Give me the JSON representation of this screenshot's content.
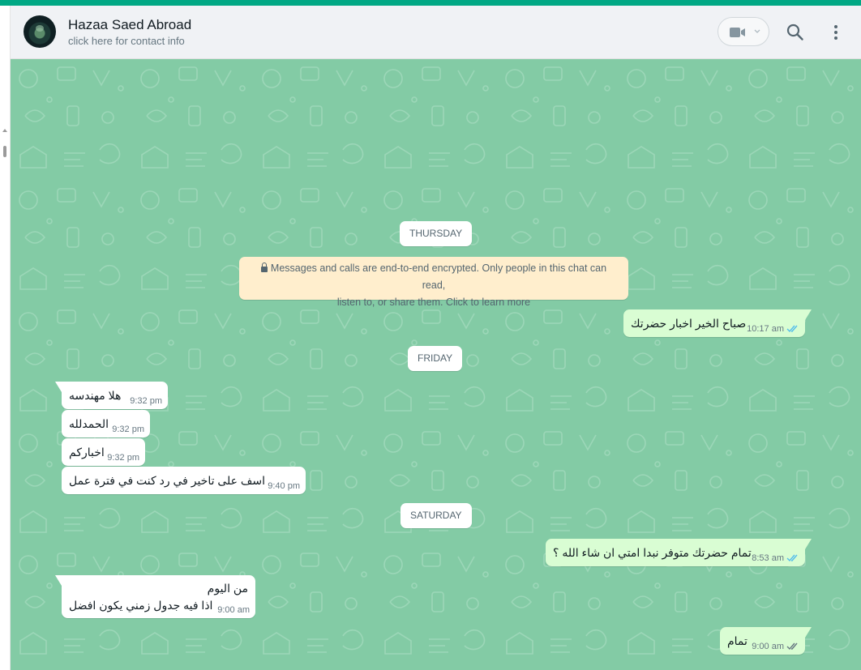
{
  "contact": {
    "name": "Hazaa Saed Abroad",
    "subtitle": "click here for contact info"
  },
  "colors": {
    "accent": "#00a884",
    "chat_bg": "#83cba5",
    "incoming": "#ffffff",
    "outgoing": "#d9fdd3",
    "system_notice": "#ffeecd",
    "read_tick": "#53bdeb"
  },
  "icons": {
    "video": "video-camera-icon",
    "search": "search-icon",
    "menu": "kebab-menu-icon",
    "lock": "lock-icon",
    "tick": "double-check-icon"
  },
  "days": {
    "thursday": "THURSDAY",
    "friday": "FRIDAY",
    "saturday": "SATURDAY"
  },
  "encryption_notice": {
    "line1": "Messages and calls are end-to-end encrypted. Only people in this chat can read,",
    "line2": "listen to, or share them. Click to learn more"
  },
  "messages": [
    {
      "text": "صباح الخير اخبار حضرتك",
      "time": "10:17 am",
      "status": "read"
    },
    {
      "text": "هلا مهندسه",
      "time": "9:32 pm"
    },
    {
      "text": "الحمدلله",
      "time": "9:32 pm"
    },
    {
      "text": "اخباركم",
      "time": "9:32 pm"
    },
    {
      "text": "اسف على تاخير في رد كنت في فترة عمل",
      "time": "9:40 pm"
    },
    {
      "text": "تمام حضرتك متوفر نبدا امتي ان شاء الله ؟",
      "time": "8:53 am",
      "status": "read"
    },
    {
      "line1": "من اليوم",
      "line2": "اذا فيه جدول زمني يكون افضل",
      "time": "9:00 am"
    },
    {
      "text": "تمام",
      "time": "9:00 am",
      "status": "delivered"
    }
  ]
}
